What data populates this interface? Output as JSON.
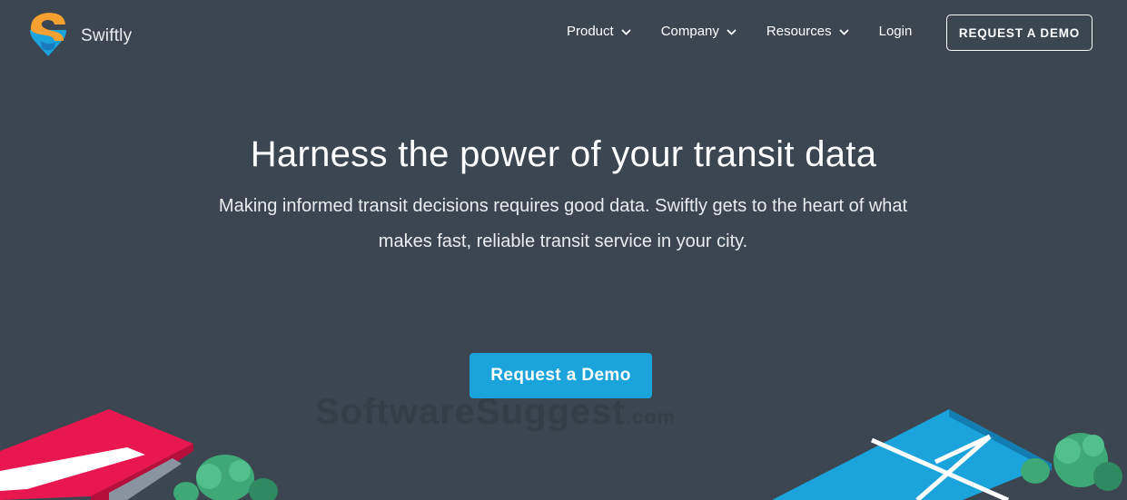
{
  "brand": {
    "name": "Swiftly"
  },
  "nav": {
    "items": [
      {
        "label": "Product"
      },
      {
        "label": "Company"
      },
      {
        "label": "Resources"
      },
      {
        "label": "Login"
      }
    ],
    "demo_label": "REQUEST A DEMO"
  },
  "hero": {
    "title": "Harness the power of your transit data",
    "subtitle": "Making informed transit decisions requires good data. Swiftly gets to the heart of what makes fast, reliable transit service in your city.",
    "cta_label": "Request a Demo"
  },
  "watermark": {
    "main": "SoftwareSuggest",
    "suffix": ".com"
  },
  "colors": {
    "background": "#3b4651",
    "accent": "#1ba3dc",
    "logo_orange": "#f5a030",
    "logo_blue": "#1ba3dc",
    "bus_red": "#e8174f",
    "tree_green": "#3ea877"
  }
}
